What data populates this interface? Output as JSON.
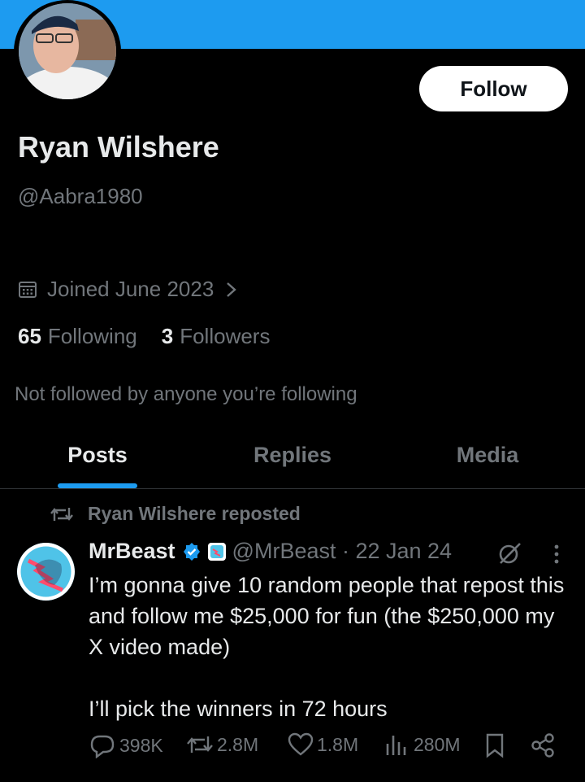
{
  "profile": {
    "name": "Ryan Wilshere",
    "handle": "@Aabra1980",
    "follow_label": "Follow",
    "joined": "Joined June 2023",
    "following_count": "65",
    "following_label": "Following",
    "followers_count": "3",
    "followers_label": "Followers",
    "not_followed_text": "Not followed by anyone you’re following"
  },
  "tabs": [
    {
      "label": "Posts",
      "active": true
    },
    {
      "label": "Replies",
      "active": false
    },
    {
      "label": "Media",
      "active": false
    }
  ],
  "post": {
    "repost_text": "Ryan Wilshere reposted",
    "author": "MrBeast",
    "handle_time": "@MrBeast · 22 Jan 24",
    "body": "I’m gonna give 10 random people that repost this and follow me $25,000 for fun (the $250,000 my X video made)\n\nI’ll pick the winners in 72 hours",
    "replies": "398K",
    "reposts": "2.8M",
    "likes": "1.8M",
    "views": "280M"
  },
  "colors": {
    "accent": "#1d9bf0",
    "background": "#000000",
    "muted": "#71767b",
    "text": "#e7e9ea"
  }
}
